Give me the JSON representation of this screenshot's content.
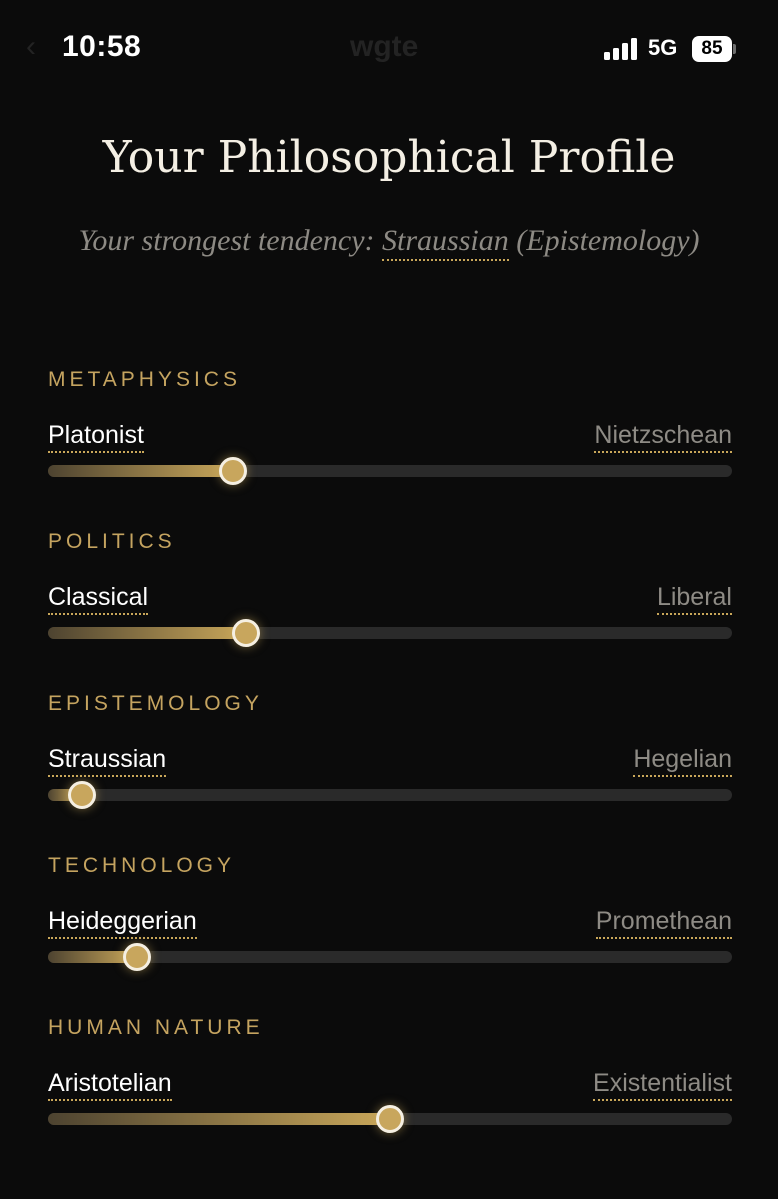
{
  "status_bar": {
    "time": "10:58",
    "network": "5G",
    "battery": "85",
    "ghost_title": "wgte"
  },
  "header": {
    "title": "Your Philosophical Profile",
    "subtitle_prefix": "Your strongest tendency: ",
    "subtitle_highlight": "Straussian",
    "subtitle_suffix": " (Epistemology)"
  },
  "dimensions": [
    {
      "label": "METAPHYSICS",
      "left_pole": "Platonist",
      "right_pole": "Nietzschean",
      "value": 0.27
    },
    {
      "label": "POLITICS",
      "left_pole": "Classical",
      "right_pole": "Liberal",
      "value": 0.29
    },
    {
      "label": "EPISTEMOLOGY",
      "left_pole": "Straussian",
      "right_pole": "Hegelian",
      "value": 0.05
    },
    {
      "label": "TECHNOLOGY",
      "left_pole": "Heideggerian",
      "right_pole": "Promethean",
      "value": 0.13
    },
    {
      "label": "HUMAN NATURE",
      "left_pole": "Aristotelian",
      "right_pole": "Existentialist",
      "value": 0.5
    }
  ],
  "colors": {
    "accent_gold": "#c9a75a",
    "background": "#0b0b0b",
    "track": "#2a2a2a"
  }
}
